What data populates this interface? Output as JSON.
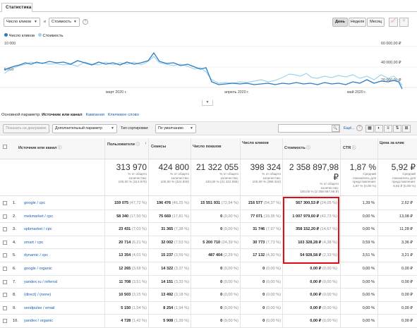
{
  "tab": "Статистика",
  "controls": {
    "metric1": "Число кликов",
    "and": "и",
    "metric2": "Стоимость",
    "periods": [
      "День",
      "Неделя",
      "Месяц"
    ],
    "active_period": "День"
  },
  "legend": [
    {
      "name": "Число кликов",
      "color": "#2b7bc4"
    },
    {
      "name": "Стоимость",
      "color": "#9fd4ef"
    }
  ],
  "chart": {
    "y_left": [
      "10 000",
      "5 000"
    ],
    "y_right": [
      "60 000,00 ₽",
      "40 000,00 ₽",
      "20 000,00 ₽"
    ],
    "x_labels": [
      "март 2020 г.",
      "апрель 2020 г.",
      "май 2020 г."
    ]
  },
  "dimension": {
    "label": "Основной параметр:",
    "active": "Источник или канал",
    "others": [
      "Кампания",
      "Ключевое слово"
    ]
  },
  "toolbar": {
    "plot_rows": "Показать на диаграмме",
    "secondary": "Дополнительный параметр",
    "sort_label": "Тип сортировки:",
    "sort_value": "По умолчанию",
    "more": "Ещё..."
  },
  "table": {
    "headers": [
      "Источник или канал",
      "Пользователи",
      "Сеансы",
      "Число показов",
      "Число кликов",
      "Стоимость",
      "CTR",
      "Цена за клик"
    ],
    "totals": [
      {
        "value": "313 970",
        "sub": [
          "% от общего",
          "количества:",
          "100,00 % (313 970)"
        ]
      },
      {
        "value": "424 800",
        "sub": [
          "% от общего",
          "количества:",
          "100,00 % (424 800)"
        ]
      },
      {
        "value": "21 322 055",
        "sub": [
          "% от общего",
          "количества:",
          "100,00 % (21 322 055)"
        ]
      },
      {
        "value": "398 324",
        "sub": [
          "% от общего",
          "количества:",
          "100,00 % (398 324)"
        ]
      },
      {
        "value": "2 358 897,98 ₽",
        "sub": [
          "% от общего",
          "количества:",
          "100,00 % (2 358 897,98 ₽)"
        ]
      },
      {
        "value": "1,87 %",
        "sub": [
          "Средний",
          "показатель для",
          "представления:",
          "1,87 % (0,00 %)"
        ]
      },
      {
        "value": "5,92 ₽",
        "sub": [
          "Средний",
          "показатель для",
          "представления:",
          "5,92 ₽ (0,00 %)"
        ]
      }
    ],
    "rows": [
      {
        "n": "1.",
        "source": "google / cpc",
        "users": "159 075",
        "users_pct": "(47,72 %)",
        "sessions": "196 476",
        "sessions_pct": "(46,25 %)",
        "impr": "15 551 931",
        "impr_pct": "(72,94 %)",
        "clicks": "216 577",
        "clicks_pct": "(54,37 %)",
        "cost": "567 300,53 ₽",
        "cost_pct": "(24,05 %)",
        "ctr": "1,39 %",
        "cpc": "2,62 ₽"
      },
      {
        "n": "2.",
        "source": "mekmarket / cpc",
        "users": "58 340",
        "users_pct": "(17,50 %)",
        "sessions": "75 669",
        "sessions_pct": "(17,81 %)",
        "impr": "0",
        "impr_pct": "(0,00 %)",
        "clicks": "77 071",
        "clicks_pct": "(19,35 %)",
        "cost": "1 007 979,60 ₽",
        "cost_pct": "(42,73 %)",
        "ctr": "0,00 %",
        "cpc": "13,08 ₽"
      },
      {
        "n": "3.",
        "source": "spbmarket / cpc",
        "users": "23 431",
        "users_pct": "(7,03 %)",
        "sessions": "31 365",
        "sessions_pct": "(7,38 %)",
        "impr": "0",
        "impr_pct": "(0,00 %)",
        "clicks": "31 746",
        "clicks_pct": "(7,97 %)",
        "cost": "358 152,20 ₽",
        "cost_pct": "(14,67 %)",
        "ctr": "0,00 %",
        "cpc": "11,28 ₽"
      },
      {
        "n": "4.",
        "source": "smart / cpc",
        "users": "20 714",
        "users_pct": "(6,21 %)",
        "sessions": "32 002",
        "sessions_pct": "(7,53 %)",
        "impr": "5 200 710",
        "impr_pct": "(24,39 %)",
        "clicks": "30 773",
        "clicks_pct": "(7,73 %)",
        "cost": "103 328,28 ₽",
        "cost_pct": "(4,38 %)",
        "ctr": "0,59 %",
        "cpc": "3,36 ₽"
      },
      {
        "n": "5.",
        "source": "dynamic / cpc",
        "users": "13 354",
        "users_pct": "(4,01 %)",
        "sessions": "15 237",
        "sessions_pct": "(3,59 %)",
        "impr": "487 404",
        "impr_pct": "(2,29 %)",
        "clicks": "17 132",
        "clicks_pct": "(4,30 %)",
        "cost": "54 928,58 ₽",
        "cost_pct": "(2,33 %)",
        "ctr": "3,51 %",
        "cpc": "3,21 ₽"
      },
      {
        "n": "6.",
        "source": "google / organic",
        "users": "12 265",
        "users_pct": "(3,68 %)",
        "sessions": "14 322",
        "sessions_pct": "(3,37 %)",
        "impr": "0",
        "impr_pct": "(0,00 %)",
        "clicks": "0",
        "clicks_pct": "(0,00 %)",
        "cost": "0,00 ₽",
        "cost_pct": "(0,00 %)",
        "ctr": "0,00 %",
        "cpc": "0,00 ₽"
      },
      {
        "n": "7.",
        "source": "yandex.ru / referral",
        "users": "11 708",
        "users_pct": "(3,51 %)",
        "sessions": "14 151",
        "sessions_pct": "(3,33 %)",
        "impr": "0",
        "impr_pct": "(0,00 %)",
        "clicks": "0",
        "clicks_pct": "(0,00 %)",
        "cost": "0,00 ₽",
        "cost_pct": "(0,00 %)",
        "ctr": "0,00 %",
        "cpc": "0,00 ₽"
      },
      {
        "n": "8.",
        "source": "(direct) / (none)",
        "users": "10 503",
        "users_pct": "(3,15 %)",
        "sessions": "13 492",
        "sessions_pct": "(3,18 %)",
        "impr": "0",
        "impr_pct": "(0,00 %)",
        "clicks": "0",
        "clicks_pct": "(0,00 %)",
        "cost": "0,00 ₽",
        "cost_pct": "(0,00 %)",
        "ctr": "0,00 %",
        "cpc": "0,00 ₽"
      },
      {
        "n": "9.",
        "source": "sendpulse / email",
        "users": "5 150",
        "users_pct": "(1,54 %)",
        "sessions": "8 254",
        "sessions_pct": "(1,94 %)",
        "impr": "0",
        "impr_pct": "(0,00 %)",
        "clicks": "0",
        "clicks_pct": "(0,00 %)",
        "cost": "0,00 ₽",
        "cost_pct": "(0,00 %)",
        "ctr": "0,00 %",
        "cpc": "0,00 ₽"
      },
      {
        "n": "10.",
        "source": "yandex / organic",
        "users": "4 728",
        "users_pct": "(1,42 %)",
        "sessions": "5 908",
        "sessions_pct": "(1,39 %)",
        "impr": "0",
        "impr_pct": "(0,00 %)",
        "clicks": "0",
        "clicks_pct": "(0,00 %)",
        "cost": "0,00 ₽",
        "cost_pct": "(0,00 %)",
        "ctr": "0,00 %",
        "cpc": "0,00 ₽"
      }
    ]
  },
  "highlight_color": "#d9111b"
}
